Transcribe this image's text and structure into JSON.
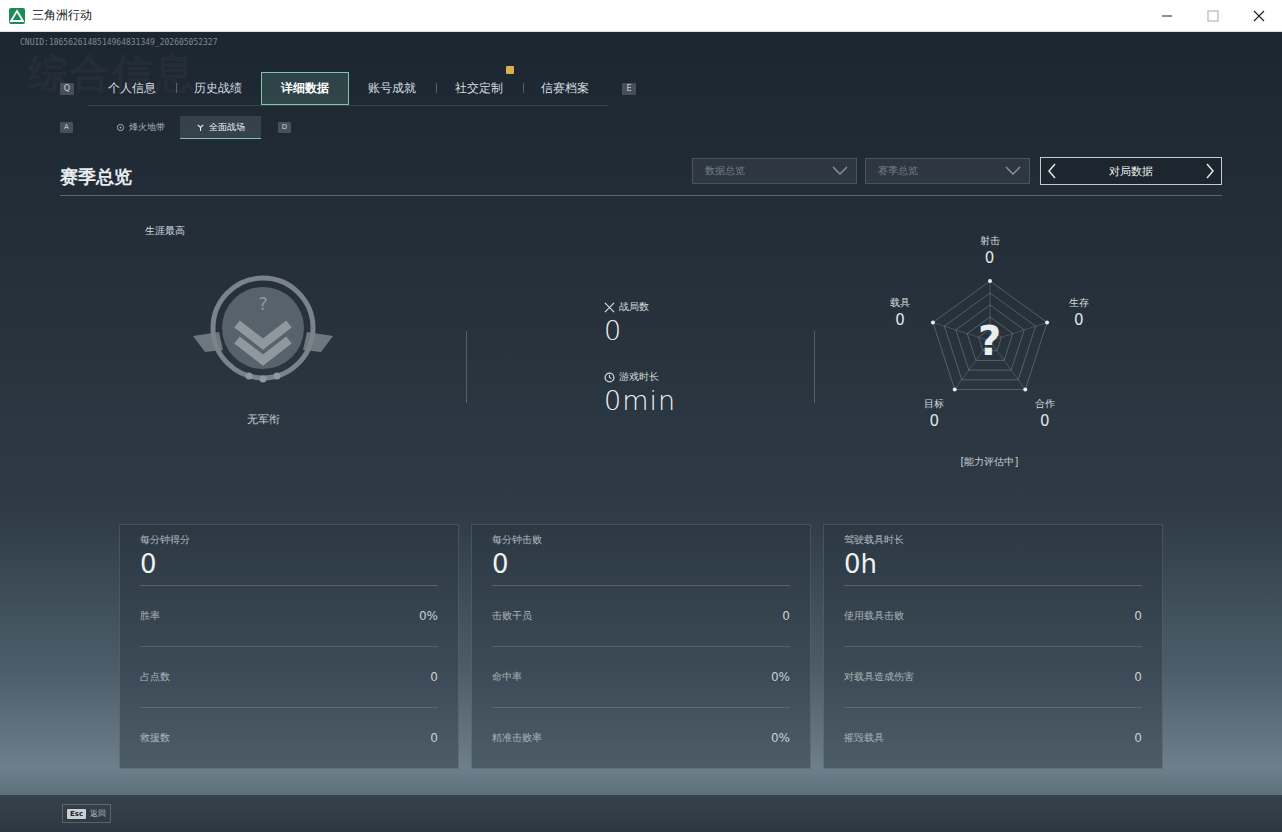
{
  "window": {
    "title": "三角洲行动"
  },
  "uid": "CNUID:1865626148514964831349_202605052327",
  "watermark": "综合信息",
  "tab_keys": {
    "prev": "Q",
    "next": "E"
  },
  "tabs": [
    {
      "label": "个人信息",
      "selected": false,
      "notice": false
    },
    {
      "label": "历史战绩",
      "selected": false,
      "notice": false
    },
    {
      "label": "详细数据",
      "selected": true,
      "notice": false
    },
    {
      "label": "账号成就",
      "selected": false,
      "notice": false
    },
    {
      "label": "社交定制",
      "selected": false,
      "notice": true
    },
    {
      "label": "信赛档案",
      "selected": false,
      "notice": false
    }
  ],
  "mode_keys": {
    "prev": "A",
    "next": "D"
  },
  "modes": [
    {
      "label": "烽火地带",
      "selected": false
    },
    {
      "label": "全面战场",
      "selected": true
    }
  ],
  "section": {
    "title": "赛季总览"
  },
  "filters": [
    {
      "label": "数据总览"
    },
    {
      "label": "赛季总览"
    }
  ],
  "switcher": {
    "label": "对局数据"
  },
  "rank": {
    "caption": "生涯最高",
    "name": "无军衔",
    "mark": "?"
  },
  "summary": [
    {
      "label": "战局数",
      "value": "0"
    },
    {
      "label": "游戏时长",
      "value": "0min"
    }
  ],
  "radar": {
    "center": "?",
    "status": "[能力评估中]",
    "axes": [
      {
        "label": "射击",
        "value": "0",
        "level": 0
      },
      {
        "label": "生存",
        "value": "0",
        "level": 0
      },
      {
        "label": "合作",
        "value": "0",
        "level": 0
      },
      {
        "label": "目标",
        "value": "0",
        "level": 0
      },
      {
        "label": "载具",
        "value": "0",
        "level": 0
      }
    ]
  },
  "cards": [
    {
      "label": "每分钟得分",
      "value": "0",
      "rows": [
        {
          "label": "胜率",
          "value": "0%"
        },
        {
          "label": "占点数",
          "value": "0"
        },
        {
          "label": "救援数",
          "value": "0"
        }
      ]
    },
    {
      "label": "每分钟击败",
      "value": "0",
      "rows": [
        {
          "label": "击败干员",
          "value": "0"
        },
        {
          "label": "命中率",
          "value": "0%"
        },
        {
          "label": "精准击败率",
          "value": "0%"
        }
      ]
    },
    {
      "label": "驾驶载具时长",
      "value": "0h",
      "rows": [
        {
          "label": "使用载具击败",
          "value": "0"
        },
        {
          "label": "对载具造成伤害",
          "value": "0"
        },
        {
          "label": "摧毁载具",
          "value": "0"
        }
      ]
    }
  ],
  "footer": {
    "key": "Esc",
    "label": "返回"
  }
}
